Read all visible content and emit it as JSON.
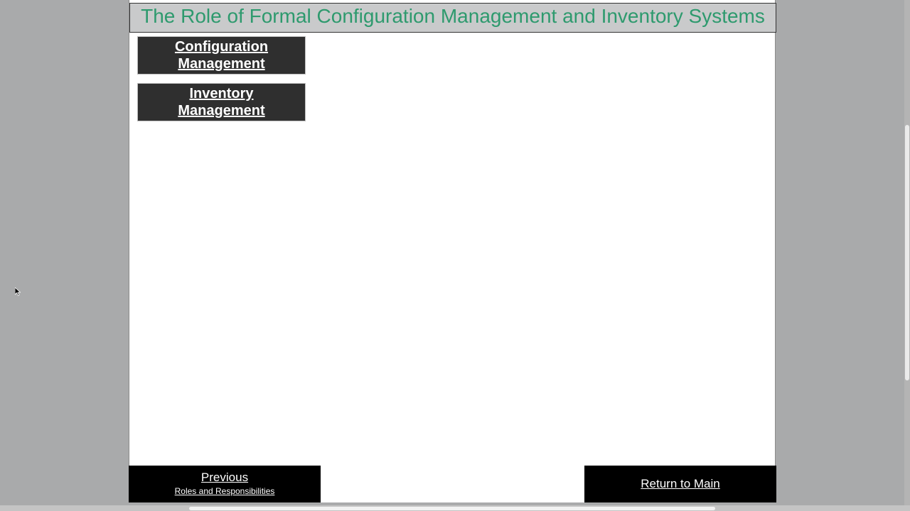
{
  "header": {
    "title": "The Role of Formal Configuration Management and Inventory Systems"
  },
  "menu": {
    "items": [
      {
        "label": "Configuration Management"
      },
      {
        "label": "Inventory Management"
      }
    ]
  },
  "footer": {
    "previous_label": "Previous",
    "previous_sub": "Roles and Responsibilities",
    "return_label": "Return to Main"
  },
  "colors": {
    "background": "#a9aaab",
    "title": "#2e9a6e",
    "header_bg": "#c9cacb",
    "menu_button_bg": "#2f2f2f",
    "nav_bg": "#000000"
  }
}
